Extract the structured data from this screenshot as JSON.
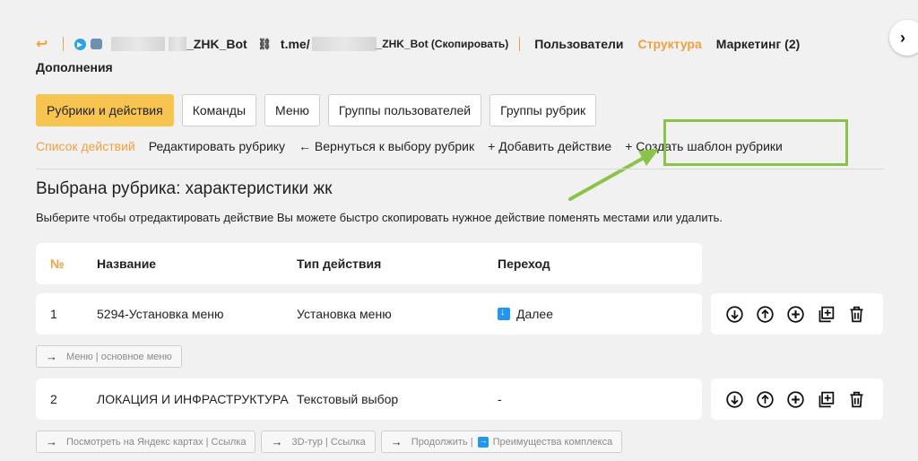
{
  "header": {
    "bot_name_suffix": "_ZHK_Bot",
    "link_prefix": "t.me/",
    "link_suffix": "_ZHK_Bot (Скопировать)",
    "nav": [
      {
        "label": "Пользователи",
        "active": false
      },
      {
        "label": "Структура",
        "active": true
      },
      {
        "label": "Маркетинг (2)",
        "active": false
      }
    ],
    "nav_extra": "Дополнения"
  },
  "tabs": [
    {
      "label": "Рубрики и действия",
      "active": true
    },
    {
      "label": "Команды",
      "active": false
    },
    {
      "label": "Меню",
      "active": false
    },
    {
      "label": "Группы пользователей",
      "active": false
    },
    {
      "label": "Группы рубрик",
      "active": false
    }
  ],
  "actions": {
    "current": "Список действий",
    "edit": "Редактировать рубрику",
    "back": "← Вернуться к выбору рубрик",
    "add": "+ Добавить действие",
    "template": "+ Создать шаблон рубрики"
  },
  "page": {
    "title": "Выбрана рубрика: характеристики жк",
    "description": "Выберите чтобы отредактировать действие Вы можете быстро скопировать нужное действие поменять местами или удалить."
  },
  "table": {
    "headers": {
      "num": "№",
      "name": "Название",
      "type": "Тип действия",
      "jump": "Переход"
    },
    "rows": [
      {
        "num": "1",
        "name": "5294-Установка меню",
        "type": "Установка меню",
        "jump": "Далее",
        "chips": [
          {
            "text": "Меню | основное меню"
          }
        ]
      },
      {
        "num": "2",
        "name": "ЛОКАЦИЯ И ИНФРАСТРУКТУРА",
        "type": "Текстовый выбор",
        "jump": "-",
        "chips": [
          {
            "text": "Посмотреть на Яндекс картах | Ссылка"
          },
          {
            "text": "3D-тур | Ссылка"
          },
          {
            "text_a": "Продолжить |",
            "text_b": "Преимущества комплекса"
          }
        ]
      }
    ]
  },
  "colors": {
    "accent": "#f0a040",
    "active_tab": "#f6c44f",
    "highlight": "#8bc34a",
    "jump_icon": "#2196f3"
  },
  "icons": [
    "back-arrow-icon",
    "telegram-icon",
    "bot-icon",
    "link-icon",
    "move-down-icon",
    "move-up-icon",
    "add-icon",
    "copy-icon",
    "trash-icon",
    "chevron-right-icon"
  ]
}
